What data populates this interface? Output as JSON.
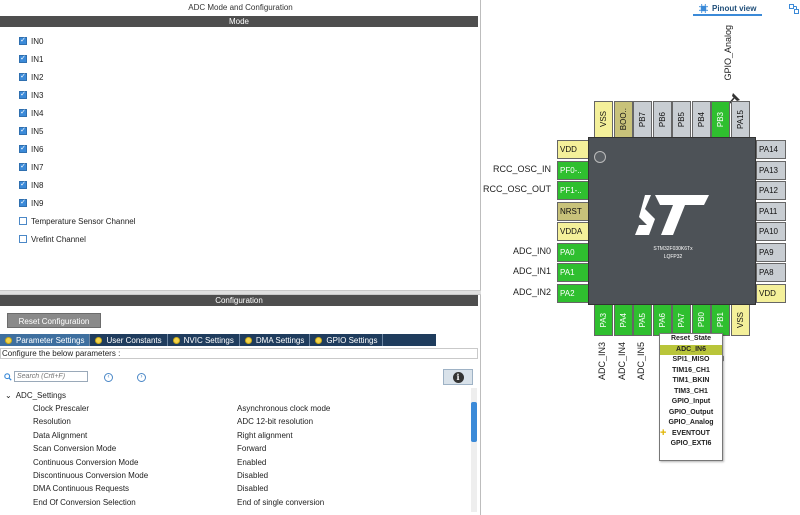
{
  "left": {
    "title": "ADC Mode and Configuration",
    "mode_bar": "Mode",
    "inputs": [
      {
        "label": "IN0",
        "checked": true
      },
      {
        "label": "IN1",
        "checked": true
      },
      {
        "label": "IN2",
        "checked": true
      },
      {
        "label": "IN3",
        "checked": true
      },
      {
        "label": "IN4",
        "checked": true
      },
      {
        "label": "IN5",
        "checked": true
      },
      {
        "label": "IN6",
        "checked": true
      },
      {
        "label": "IN7",
        "checked": true
      },
      {
        "label": "IN8",
        "checked": true
      },
      {
        "label": "IN9",
        "checked": true
      },
      {
        "label": "Temperature Sensor Channel",
        "checked": false
      },
      {
        "label": "Vrefint Channel",
        "checked": false
      }
    ],
    "config_bar": "Configuration",
    "reset_button": "Reset Configuration",
    "tabs": [
      "Parameter Settings",
      "User Constants",
      "NVIC Settings",
      "DMA Settings",
      "GPIO Settings"
    ],
    "active_tab": "Parameter Settings",
    "configure_label": "Configure the below parameters :",
    "search_placeholder": "Search (Crtl+F)",
    "info_glyph": "i",
    "settings_group": "ADC_Settings",
    "params": [
      {
        "name": "Clock Prescaler",
        "value": "Asynchronous clock mode"
      },
      {
        "name": "Resolution",
        "value": "ADC 12-bit resolution"
      },
      {
        "name": "Data Alignment",
        "value": "Right alignment"
      },
      {
        "name": "Scan Conversion Mode",
        "value": "Forward"
      },
      {
        "name": "Continuous Conversion Mode",
        "value": "Enabled"
      },
      {
        "name": "Discontinuous Conversion Mode",
        "value": "Disabled"
      },
      {
        "name": "DMA Continuous Requests",
        "value": "Disabled"
      },
      {
        "name": "End Of Conversion Selection",
        "value": "End of single conversion"
      }
    ]
  },
  "right": {
    "view_tab": "Pinout view",
    "top_label": "GPIO_Analog",
    "top_pins": [
      "VSS",
      "BOO..",
      "PB7",
      "PB6",
      "PB5",
      "PB4",
      "PB3",
      "PA15"
    ],
    "left_pins": [
      "VDD",
      "PF0-..",
      "PF1-..",
      "NRST",
      "VDDA",
      "PA0",
      "PA1",
      "PA2"
    ],
    "left_labels": [
      "",
      "RCC_OSC_IN",
      "RCC_OSC_OUT",
      "",
      "",
      "ADC_IN0",
      "ADC_IN1",
      "ADC_IN2"
    ],
    "right_pins": [
      "PA14",
      "PA13",
      "PA12",
      "PA11",
      "PA10",
      "PA9",
      "PA8",
      "VDD"
    ],
    "bottom_pins": [
      "PA3",
      "PA4",
      "PA5",
      "PA6",
      "PA7",
      "PB0",
      "PB1",
      "VSS"
    ],
    "bottom_labels": [
      "ADC_IN3",
      "ADC_IN4",
      "ADC_IN5",
      "",
      "",
      "",
      "ADC_IN9",
      ""
    ],
    "chip_part": "STM32F030K6Tx",
    "chip_package": "LQFP32",
    "popup": [
      "Reset_State",
      "ADC_IN6",
      "SPI1_MISO",
      "TIM16_CH1",
      "TIM1_BKIN",
      "TIM3_CH1",
      "GPIO_Input",
      "GPIO_Output",
      "GPIO_Analog",
      "EVENTOUT",
      "GPIO_EXTI6"
    ],
    "popup_selected": "ADC_IN6",
    "popup_plus": "+",
    "colors": {
      "green": "#2fbf2f",
      "yellow": "#f4f09a",
      "gray": "#c8cdd2",
      "chip": "#4d5257",
      "tab_bar": "#1f3c5d",
      "selected": "#b9c53a"
    }
  }
}
